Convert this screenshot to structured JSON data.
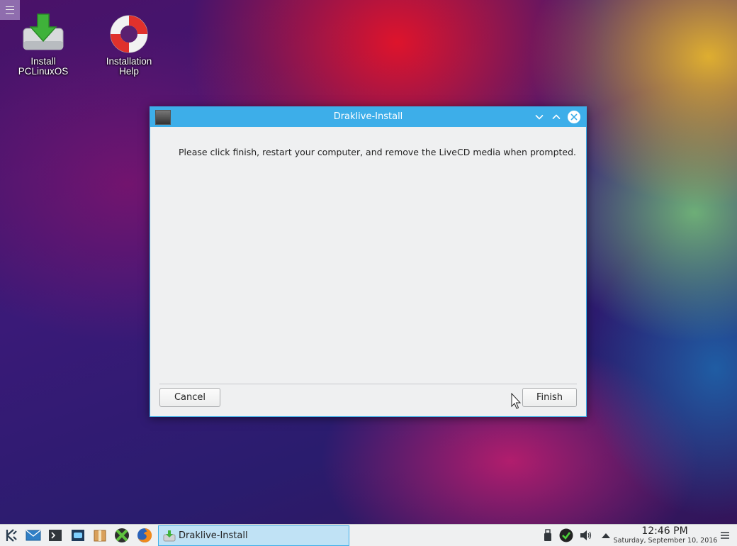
{
  "desktop": {
    "icons": [
      {
        "label_line1": "Install",
        "label_line2": "PCLinuxOS"
      },
      {
        "label_line1": "Installation",
        "label_line2": "Help"
      }
    ]
  },
  "dialog": {
    "title": "Draklive-Install",
    "message": "Please click finish, restart your computer, and remove the LiveCD media when prompted.",
    "cancel_label": "Cancel",
    "finish_label": "Finish"
  },
  "taskbar": {
    "task_label": "Draklive-Install",
    "clock_time": "12:46 PM",
    "clock_date": "Saturday, September 10, 2016"
  },
  "colors": {
    "accent": "#3daee9",
    "window_bg": "#eff0f1"
  }
}
